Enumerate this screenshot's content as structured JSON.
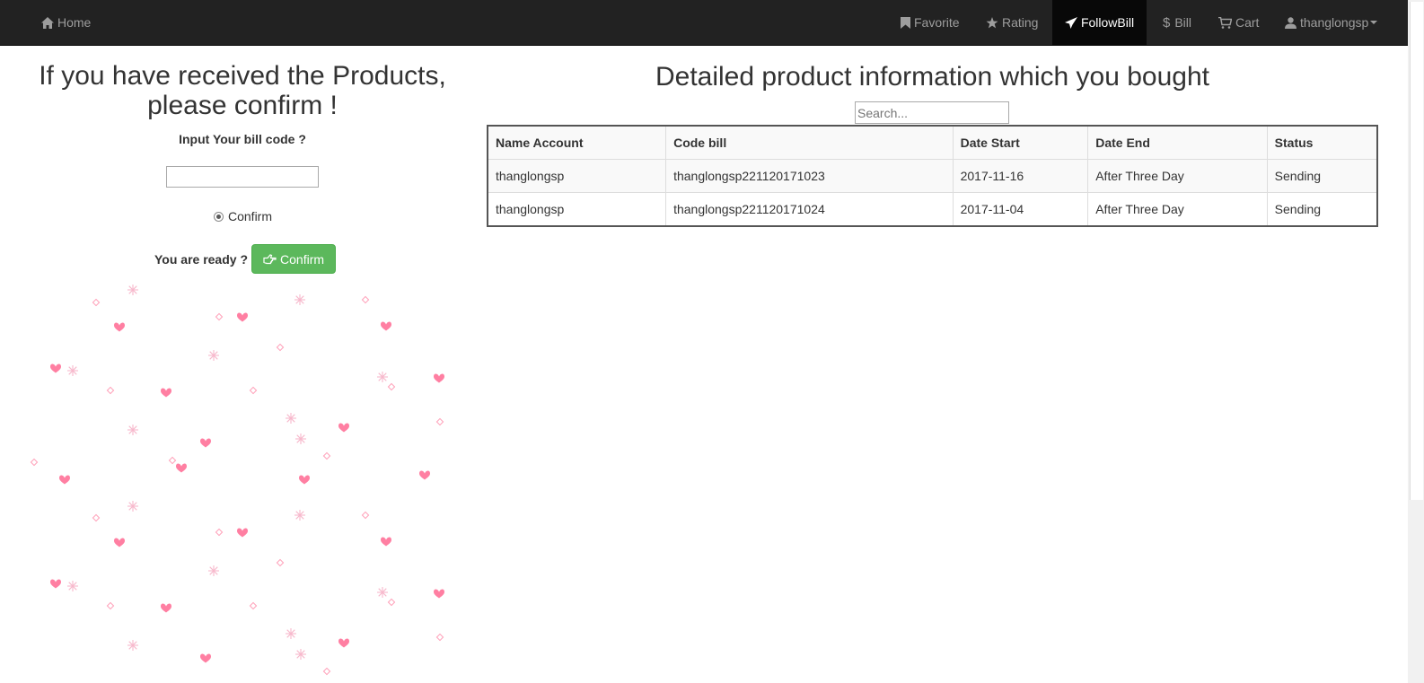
{
  "navbar": {
    "home": "Home",
    "favorite": "Favorite",
    "rating": "Rating",
    "followbill": "FollowBill",
    "bill": "Bill",
    "cart": "Cart",
    "user": "thanglongsp",
    "icons": {
      "home": "home-icon",
      "favorite": "bookmark-icon",
      "rating": "star-icon",
      "followbill": "send-icon",
      "bill": "dollar-icon",
      "cart": "cart-icon",
      "user": "user-icon"
    },
    "colors": {
      "background": "#222222",
      "active": "#080808"
    }
  },
  "confirm_panel": {
    "heading": "If you have received the Products, please confirm !",
    "bill_code_label": "Input Your bill code ?",
    "bill_code_value": "",
    "radio_label": "Confirm",
    "ready_label": "You are ready ?",
    "confirm_button": "Confirm",
    "button_color": "#5cb85c"
  },
  "bill_panel": {
    "heading": "Detailed product information which you bought",
    "search_placeholder": "Search...",
    "columns": [
      "Name Account",
      "Code bill",
      "Date Start",
      "Date End",
      "Status"
    ],
    "rows": [
      [
        "thanglongsp",
        "thanglongsp221120171023",
        "2017-11-16",
        "After Three Day",
        "Sending"
      ],
      [
        "thanglongsp",
        "thanglongsp221120171024",
        "2017-11-04",
        "After Three Day",
        "Sending"
      ]
    ]
  }
}
